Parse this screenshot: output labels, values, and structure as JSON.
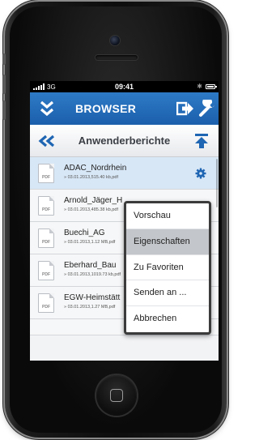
{
  "status_bar": {
    "carrier": "3G",
    "time": "09:41"
  },
  "top_bar": {
    "title": "BROWSER",
    "color": "#1f66b3"
  },
  "sub_bar": {
    "folder_title": "Anwenderberichte"
  },
  "files": [
    {
      "name": "ADAC_Nordrhein",
      "meta": "» 03.01.2013,515.40 kb,pdf",
      "selected": true
    },
    {
      "name": "Arnold_Jäger_H",
      "meta": "» 03.01.2013,485.38 kb,pdf",
      "selected": false
    },
    {
      "name": "Buechi_AG",
      "meta": "» 03.01.2013,1.12 MB,pdf",
      "selected": false
    },
    {
      "name": "Eberhard_Bau",
      "meta": "» 03.01.2013,1019.73 kb,pdf",
      "selected": false
    },
    {
      "name": "EGW-Heimstätt",
      "meta": "» 03.01.2013,1.27 MB,pdf",
      "selected": false
    }
  ],
  "file_icon_label": "PDF",
  "context_menu": {
    "items": [
      {
        "label": "Vorschau",
        "highlighted": false
      },
      {
        "label": "Eigenschaften",
        "highlighted": true
      },
      {
        "label": "Zu Favoriten",
        "highlighted": false
      },
      {
        "label": "Senden an ...",
        "highlighted": false
      },
      {
        "label": "Abbrechen",
        "highlighted": false
      }
    ]
  }
}
